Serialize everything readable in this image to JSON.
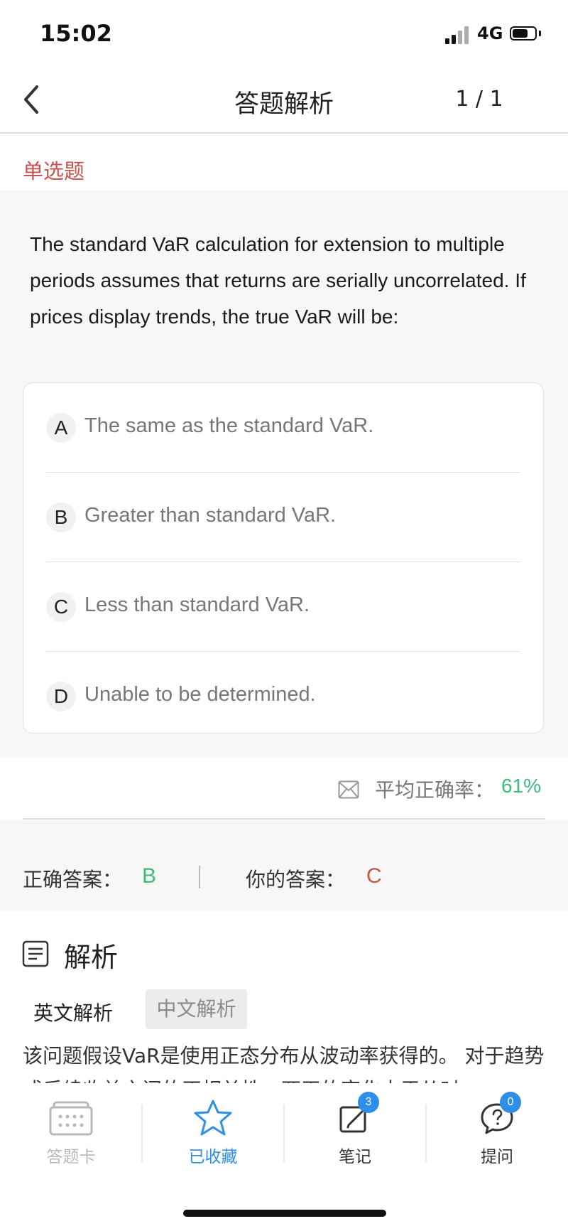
{
  "status_bar": {
    "time": "15:02",
    "network": "4G",
    "battery_level": 0.7
  },
  "nav": {
    "title": "答题解析",
    "page_indicator": "1 / 1"
  },
  "question": {
    "type_label": "单选题",
    "text": "The standard VaR calculation for extension to multiple periods assumes that returns are serially uncorrelated. If prices display trends, the true VaR will be:",
    "options": [
      {
        "letter": "A",
        "text": "The same as the standard VaR."
      },
      {
        "letter": "B",
        "text": "Greater than standard VaR."
      },
      {
        "letter": "C",
        "text": "Less than standard VaR."
      },
      {
        "letter": "D",
        "text": "Unable to be determined."
      }
    ]
  },
  "stats": {
    "avg_label": "平均正确率：",
    "avg_value": "61%"
  },
  "answers": {
    "correct_label": "正确答案：",
    "correct_value": "B",
    "yours_label": "你的答案：",
    "yours_value": "C"
  },
  "analysis": {
    "title": "解析",
    "tab_en": "英文解析",
    "tab_cn": "中文解析",
    "text": "该问题假设VaR是使用正态分布从波动率获得的。 对于趋势或后续收益之间的正相关性，两天的变化大于从时"
  },
  "tabbar": {
    "items": [
      {
        "label": "答题卡",
        "icon": "answer-card-icon",
        "color": "#b9b9b9"
      },
      {
        "label": "已收藏",
        "icon": "star-icon",
        "color": "#2e8fe8"
      },
      {
        "label": "笔记",
        "icon": "edit-note-icon",
        "color": "#333333",
        "badge": "3"
      },
      {
        "label": "提问",
        "icon": "question-bubble-icon",
        "color": "#333333",
        "badge": "0"
      }
    ]
  },
  "colors": {
    "accent_red": "#c9524d",
    "accent_green": "#3dbb7a",
    "accent_blue": "#2e8fe8"
  }
}
